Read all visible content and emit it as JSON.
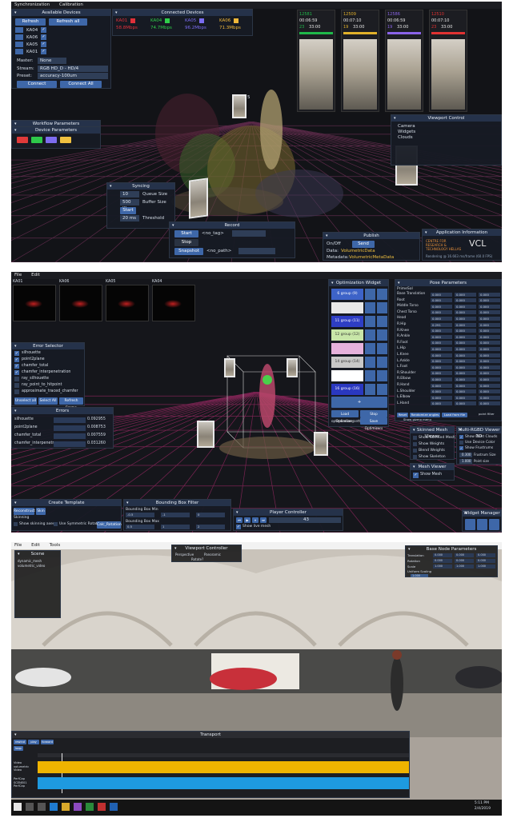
{
  "s1": {
    "menu": [
      "Synchronization",
      "Calibration"
    ],
    "devices_panel": {
      "title": "Available Devices",
      "refresh": "Refresh",
      "refresh_all": "Refresh all",
      "devices": [
        "KA04",
        "KA06",
        "KA05",
        "KA01"
      ],
      "master_label": "Master:",
      "master_value": "None",
      "stream_label": "Stream:",
      "stream_value": "RGB HD_D - HD/4",
      "preset_label": "Preset:",
      "preset_value": "accuracy-100um",
      "connect": "Connect",
      "connect_all": "Connect All"
    },
    "connected": {
      "title": "Connected Devices",
      "devices": [
        {
          "name": "KA01",
          "rate": "58.8Mbps",
          "color": "#e0303a"
        },
        {
          "name": "KA04",
          "rate": "74.7Mbps",
          "color": "#2fd04a"
        },
        {
          "name": "KA05",
          "rate": "96.2Mbps",
          "color": "#7a6cf0"
        },
        {
          "name": "KA06",
          "rate": "71.3Mbps",
          "color": "#f0b83a"
        }
      ]
    },
    "cams": [
      {
        "id": "12581",
        "t1": "00:06:59",
        "t2": "23",
        "t3": "33:00",
        "color": "#1fb84a"
      },
      {
        "id": "12509",
        "t1": "00:07:10",
        "t2": "19",
        "t3": "33:00",
        "color": "#e0b02a"
      },
      {
        "id": "12586",
        "t1": "00:06:59",
        "t2": "19",
        "t3": "33:00",
        "color": "#8a64e8"
      },
      {
        "id": "12510",
        "t1": "00:07:10",
        "t2": "23",
        "t3": "33:00",
        "color": "#e03232"
      }
    ],
    "workflow": "Workflow Parameters",
    "device_params": "Device Parameters",
    "device_colors": [
      "#e03a3a",
      "#2ec84a",
      "#7d6cf0",
      "#f0c040"
    ],
    "viewport": {
      "title": "Viewport Control",
      "items": [
        "Camera",
        "Widgets",
        "Clouds"
      ]
    },
    "syncing": {
      "title": "Syncing",
      "queue_value": "10",
      "queue_label": "Queue Size",
      "buffer_value": "500 Kbs",
      "buffer_label": "Buffer Size",
      "start": "Start",
      "threshold_value": "20 ms",
      "threshold_label": "Threshold"
    },
    "record": {
      "title": "Record",
      "start": "Start",
      "stop": "Stop",
      "snapshot": "Snapshot",
      "tag": "<no_tag>",
      "path": "<no_path>"
    },
    "publish": {
      "title": "Publish",
      "onoff": "On/Off",
      "send": "Send",
      "data_label": "Data:",
      "data_value": "VolumetricData",
      "meta_label": "Metadata:",
      "meta_value": "VolumetricMetaData"
    },
    "appinfo": {
      "title": "Application Information",
      "logo": "VCL",
      "org": "CENTRE FOR RESEARCH & TECHNOLOGY HELLAS",
      "render": "Rendering @ 16.663 ms/frame (60.0 FPS)"
    },
    "marker": "5"
  },
  "s2": {
    "menu": [
      "File",
      "Edit"
    ],
    "thumbs": [
      "KA01",
      "KA06",
      "KA05",
      "KA04"
    ],
    "error_selector": {
      "title": "Error Selector",
      "items": [
        {
          "label": "silhouette",
          "checked": true
        },
        {
          "label": "point2plane",
          "checked": true
        },
        {
          "label": "chamfer_total",
          "checked": true
        },
        {
          "label": "chamfer_interpenetration",
          "checked": true
        },
        {
          "label": "ray_silhouette",
          "checked": false
        },
        {
          "label": "ray_point_to_hitpoint",
          "checked": false
        },
        {
          "label": "approximate_traced_chamfer",
          "checked": false
        }
      ],
      "unselect": "Unselect all",
      "select": "Select All",
      "refresh": "Refresh Frame"
    },
    "errors": {
      "title": "Errors",
      "rows": [
        {
          "label": "silhouette",
          "value": "0.092955"
        },
        {
          "label": "point2plane",
          "value": "0.008753"
        },
        {
          "label": "chamfer_total",
          "value": "0.007559"
        },
        {
          "label": "chamfer_interpenetr",
          "value": "0.031260"
        }
      ]
    },
    "optimization": {
      "title": "Optimization Widget",
      "groups": [
        {
          "label": "6 group (9)",
          "color": "#3d63c8"
        },
        {
          "label": "",
          "color": "#e8e8e8"
        },
        {
          "label": "11 group (11)",
          "color": "#2e3ec4"
        },
        {
          "label": "12 group (12)",
          "color": "#c8e6a8"
        },
        {
          "label": "",
          "color": "#e6b2dc"
        },
        {
          "label": "14 group (14)",
          "color": "#c8c8c8"
        },
        {
          "label": "",
          "color": "#ffffff"
        },
        {
          "label": "16 group (16)",
          "color": "#2a38c0"
        }
      ],
      "plus": "+",
      "load": "Load Optimizers",
      "stop": "Stop Optimization",
      "settings": "optimization_settings",
      "save": "Save Optimizers",
      "name": "name"
    },
    "pose": {
      "title": "Pose Parameters",
      "section": "PrimeSol",
      "rows": [
        {
          "label": "Base Translation",
          "v": [
            "0.000",
            "0.000",
            "0.000"
          ]
        },
        {
          "label": "Root",
          "v": [
            "0.000",
            "0.000",
            "0.000"
          ]
        },
        {
          "label": "Middle Torso",
          "v": [
            "0.000",
            "0.000",
            "0.000"
          ]
        },
        {
          "label": "Chest Torso",
          "v": [
            "0.000",
            "0.000",
            "0.000"
          ]
        },
        {
          "label": "Head",
          "v": [
            "0.000",
            "0.000",
            "0.000"
          ]
        },
        {
          "label": "R.Hip",
          "v": [
            "0.291",
            "0.000",
            "0.000"
          ]
        },
        {
          "label": "R.Knee",
          "v": [
            "0.000",
            "0.000",
            "0.000"
          ]
        },
        {
          "label": "R.Ankle",
          "v": [
            "0.000",
            "0.000",
            "0.000"
          ]
        },
        {
          "label": "R.Foot",
          "v": [
            "0.000",
            "0.000",
            "0.000"
          ]
        },
        {
          "label": "L.Hip",
          "v": [
            "0.000",
            "0.000",
            "0.000"
          ]
        },
        {
          "label": "L.Knee",
          "v": [
            "0.000",
            "0.000",
            "0.000"
          ]
        },
        {
          "label": "L.Ankle",
          "v": [
            "0.000",
            "0.000",
            "0.000"
          ]
        },
        {
          "label": "L.Foot",
          "v": [
            "0.000",
            "0.000",
            "0.000"
          ]
        },
        {
          "label": "R.Shoulder",
          "v": [
            "0.000",
            "0.000",
            "0.000"
          ]
        },
        {
          "label": "R.Elbow",
          "v": [
            "0.000",
            "0.000",
            "0.000"
          ]
        },
        {
          "label": "R.Hand",
          "v": [
            "0.000",
            "0.000",
            "0.000"
          ]
        },
        {
          "label": "L.Shoulder",
          "v": [
            "0.000",
            "0.000",
            "0.000"
          ]
        },
        {
          "label": "L.Elbow",
          "v": [
            "0.000",
            "0.000",
            "0.000"
          ]
        },
        {
          "label": "L.Hand",
          "v": [
            "0.000",
            "0.000",
            "0.000"
          ]
        }
      ],
      "reset": "Reset",
      "random": "Randomize angles",
      "loadfile": "Load from file",
      "filter": "point filter",
      "gizmo": "Show gizmo menu"
    },
    "skinned": {
      "title": "Skinned Mesh Viewer",
      "items": [
        "Show Skinned Mesh",
        "Show Weights",
        "Blend Weights",
        "Show Skeleton"
      ]
    },
    "multi": {
      "title": "Multi-RGBD Viewer 3D",
      "items": [
        "Show Point Clouds",
        "Use Device Color",
        "Show Frustrums"
      ],
      "frustum_value": "0.300",
      "frustum_label": "Frustrum Size",
      "point_value": "1.000",
      "point_label": "Point size"
    },
    "mesh": {
      "title": "Mesh Viewer",
      "item": "Show Mesh"
    },
    "create": {
      "title": "Create Template",
      "reconstruct": "Reconstruct",
      "skin": "Skin",
      "skinning": "Skinning",
      "show_skin": "Show skinning axes",
      "symm": "Use Symmetric Rotation",
      "calc": "Calc_Rotation"
    },
    "bbox": {
      "title": "Bounding Box Filter",
      "min": "Bounding Box Min",
      "max": "Bounding Box Max",
      "vmin": [
        "-0.5",
        "-1",
        "0"
      ],
      "vmax": [
        "0.5",
        "1",
        "2"
      ]
    },
    "player": {
      "title": "Player Controller",
      "frame": "43",
      "show": "Show live mesh"
    },
    "widget_manager": "Widget Manager"
  },
  "s3": {
    "menu": [
      "File",
      "Edit",
      "Tools"
    ],
    "scene": {
      "title": "Scene",
      "items": [
        "dynamic_mesh",
        "volumetric_video"
      ]
    },
    "viewport": {
      "title": "Viewport Controller",
      "persp": "Perspective",
      "pano": "Panoramic",
      "rotate": "Rotate?"
    },
    "bone": {
      "title": "Base Node Parameters",
      "translation": "Translation",
      "rotation": "Rotation",
      "scale": "Scale",
      "uniform": "Uniform Scaling",
      "t": [
        "0.000",
        "0.000",
        "0.000"
      ],
      "r": [
        "0.000",
        "0.000",
        "0.000"
      ],
      "s": [
        "1.000",
        "1.000",
        "1.000"
      ],
      "u": "1.000"
    },
    "transport": {
      "title": "Transport",
      "rewind": "rewind",
      "play": "play",
      "forward": "forward",
      "loop": "loop"
    },
    "tracks": [
      {
        "label": "Video\nvolumetric\nVideo",
        "color": "#f0b400"
      },
      {
        "label": "PerfCap\nSCENE01\nPerfCap",
        "color": "#1e9ae0"
      }
    ],
    "taskbar": {
      "time": "5:11 PM",
      "date": "2/4/2019"
    }
  }
}
